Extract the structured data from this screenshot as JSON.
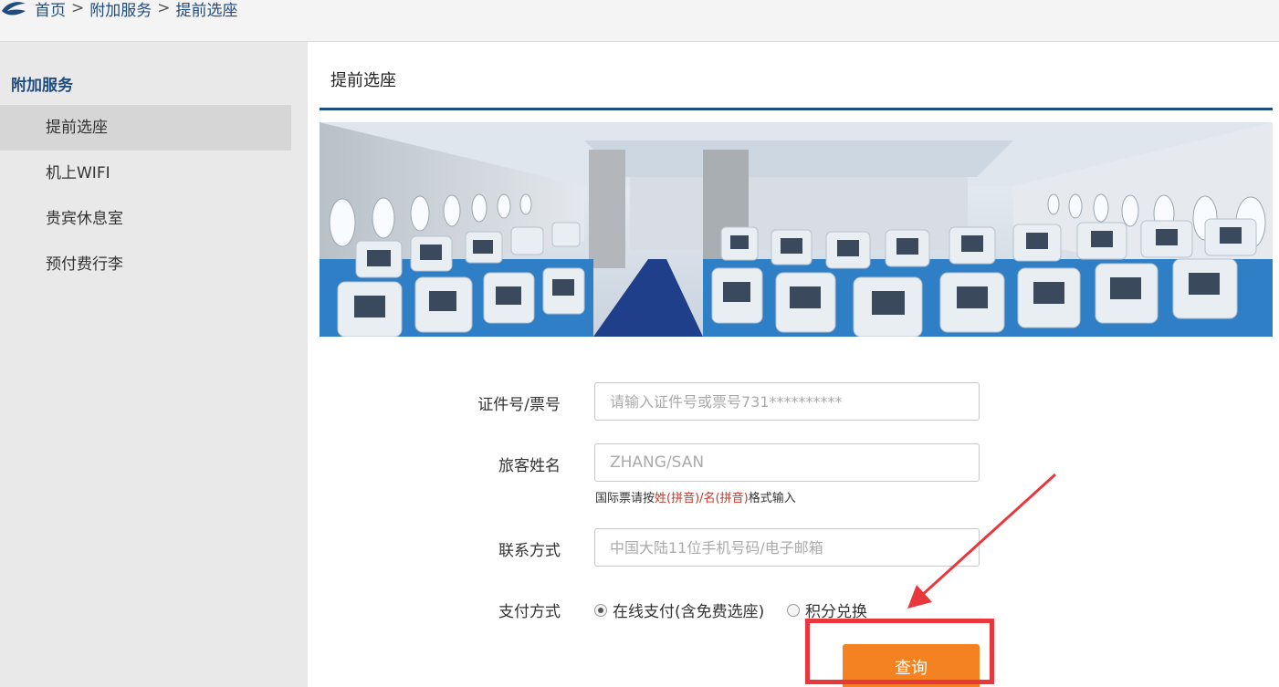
{
  "breadcrumb": {
    "items": [
      "首页",
      "附加服务",
      "提前选座"
    ],
    "separator": ">"
  },
  "sidebar": {
    "title": "附加服务",
    "items": [
      {
        "label": "提前选座",
        "active": true
      },
      {
        "label": "机上WIFI",
        "active": false
      },
      {
        "label": "贵宾休息室",
        "active": false
      },
      {
        "label": "预付费行李",
        "active": false
      }
    ]
  },
  "main": {
    "title": "提前选座",
    "banner_alt": "cabin-interior-image"
  },
  "form": {
    "id_label": "证件号/票号",
    "id_placeholder": "请输入证件号或票号731**********",
    "name_label": "旅客姓名",
    "name_placeholder": "ZHANG/SAN",
    "name_hint_prefix": "国际票请按",
    "name_hint_surname": "姓(拼音)",
    "name_hint_slash": "/",
    "name_hint_given": "名(拼音)",
    "name_hint_suffix": "格式输入",
    "contact_label": "联系方式",
    "contact_placeholder": "中国大陆11位手机号码/电子邮箱",
    "payment_label": "支付方式",
    "payment_options": [
      {
        "label": "在线支付(含免费选座)",
        "checked": true
      },
      {
        "label": "积分兑换",
        "checked": false
      }
    ],
    "submit_label": "查询"
  },
  "colors": {
    "brand_blue": "#1f4d7f",
    "button_orange": "#f58220",
    "annotation_red": "#e8383d",
    "hint_red": "#c0392b"
  }
}
